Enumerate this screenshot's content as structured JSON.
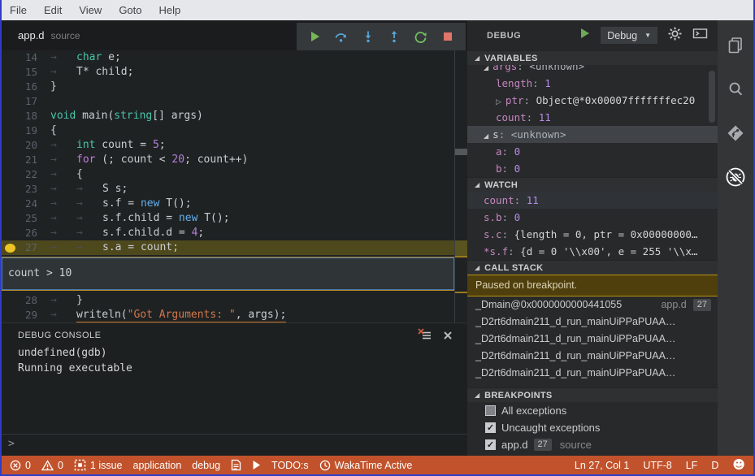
{
  "window": {
    "border_color": "#2F3DC4"
  },
  "menu_bar": {
    "items": [
      "File",
      "Edit",
      "View",
      "Goto",
      "Help"
    ]
  },
  "tab_bar": {
    "title": "app.d",
    "subtitle": "source"
  },
  "debug_toolbar": {
    "buttons": [
      "continue",
      "step-over",
      "step-into",
      "step-out",
      "restart",
      "stop"
    ]
  },
  "editor": {
    "current_line": 27,
    "breakpoint_line": 27,
    "lines": [
      {
        "num": "14",
        "segs": [
          [
            "tab",
            "→"
          ],
          [
            "type",
            "char"
          ],
          [
            "plain",
            " e;"
          ]
        ]
      },
      {
        "num": "15",
        "segs": [
          [
            "tab",
            "→"
          ],
          [
            "plain",
            "T* child;"
          ]
        ]
      },
      {
        "num": "16",
        "segs": [
          [
            "plain",
            "}"
          ]
        ]
      },
      {
        "num": "17",
        "segs": []
      },
      {
        "num": "18",
        "segs": [
          [
            "type",
            "void"
          ],
          [
            "plain",
            " main("
          ],
          [
            "type",
            "string"
          ],
          [
            "plain",
            "[] args)"
          ]
        ]
      },
      {
        "num": "19",
        "segs": [
          [
            "plain",
            "{"
          ]
        ]
      },
      {
        "num": "20",
        "segs": [
          [
            "tab",
            "→"
          ],
          [
            "type",
            "int"
          ],
          [
            "plain",
            " count = "
          ],
          [
            "num",
            "5"
          ],
          [
            "plain",
            ";"
          ]
        ]
      },
      {
        "num": "21",
        "segs": [
          [
            "tab",
            "→"
          ],
          [
            "ctrl",
            "for"
          ],
          [
            "plain",
            " (; count < "
          ],
          [
            "num",
            "20"
          ],
          [
            "plain",
            "; count++)"
          ]
        ]
      },
      {
        "num": "22",
        "segs": [
          [
            "tab",
            "→"
          ],
          [
            "plain",
            "{"
          ]
        ]
      },
      {
        "num": "23",
        "segs": [
          [
            "tab",
            "→"
          ],
          [
            "tab",
            "→"
          ],
          [
            "plain",
            "S s;"
          ]
        ]
      },
      {
        "num": "24",
        "segs": [
          [
            "tab",
            "→"
          ],
          [
            "tab",
            "→"
          ],
          [
            "plain",
            "s.f = "
          ],
          [
            "new",
            "new"
          ],
          [
            "plain",
            " T();"
          ]
        ]
      },
      {
        "num": "25",
        "segs": [
          [
            "tab",
            "→"
          ],
          [
            "tab",
            "→"
          ],
          [
            "plain",
            "s.f.child = "
          ],
          [
            "new",
            "new"
          ],
          [
            "plain",
            " T();"
          ]
        ]
      },
      {
        "num": "26",
        "segs": [
          [
            "tab",
            "→"
          ],
          [
            "tab",
            "→"
          ],
          [
            "plain",
            "s.f.child.d = "
          ],
          [
            "num",
            "4"
          ],
          [
            "plain",
            ";"
          ]
        ]
      },
      {
        "num": "27",
        "current": true,
        "breakpoint": true,
        "segs": [
          [
            "tab",
            "→"
          ],
          [
            "tab",
            "→"
          ],
          [
            "plain",
            "s.a = count;"
          ]
        ]
      },
      {
        "widget": true,
        "value": "count > 10"
      },
      {
        "num": "28",
        "segs": [
          [
            "tab",
            "→"
          ],
          [
            "plain",
            "}"
          ]
        ]
      },
      {
        "num": "29",
        "warn": true,
        "segs": [
          [
            "tab",
            "→"
          ],
          [
            "plain",
            "writeln("
          ],
          [
            "str",
            "\"Got Arguments: \""
          ],
          [
            "plain",
            ", args);"
          ]
        ]
      }
    ]
  },
  "debug_console": {
    "title": "DEBUG CONSOLE",
    "lines": [
      "undefined(gdb)",
      "Running executable"
    ],
    "prompt": ">"
  },
  "panel": {
    "title": "DEBUG",
    "config": "Debug",
    "variables": {
      "title": "VARIABLES",
      "rows": [
        {
          "clip": true,
          "indent": 1,
          "arrow": "open",
          "name": "args",
          "value": "<unknown>",
          "vt": "unk"
        },
        {
          "indent": 2,
          "name": "length",
          "value": "1",
          "vt": "num"
        },
        {
          "indent": 2,
          "arrow": "closed",
          "name": "ptr",
          "value": "Object@*0x00007fffffffec20",
          "vt": "obj"
        },
        {
          "indent": 2,
          "name": "count",
          "value": "11",
          "vt": "num"
        },
        {
          "indent": 1,
          "arrow": "open",
          "name": "s",
          "value": "<unknown>",
          "vt": "unk",
          "selected": true,
          "plain": true
        },
        {
          "indent": 2,
          "name": "a",
          "value": "0",
          "vt": "num"
        },
        {
          "indent": 2,
          "name": "b",
          "value": "0",
          "vt": "num"
        }
      ]
    },
    "watch": {
      "title": "WATCH",
      "rows": [
        {
          "name": "count",
          "value": "11",
          "vt": "num",
          "hover": true
        },
        {
          "name": "s.b",
          "value": "0",
          "vt": "num"
        },
        {
          "name": "s.c",
          "value": "{length = 0, ptr = 0x00000000…",
          "vt": "obj"
        },
        {
          "name": "*s.f",
          "value": "{d = 0 '\\\\x00', e = 255 '\\\\x…",
          "vt": "obj"
        }
      ]
    },
    "call_stack": {
      "title": "CALL STACK",
      "status": "Paused on breakpoint.",
      "frames": [
        {
          "label": "_Dmain@0x0000000000441055",
          "file": "app.d",
          "line": "27"
        },
        {
          "label": "_D2rt6dmain211_d_run_mainUiPPaPUAA…"
        },
        {
          "label": "_D2rt6dmain211_d_run_mainUiPPaPUAA…"
        },
        {
          "label": "_D2rt6dmain211_d_run_mainUiPPaPUAA…"
        },
        {
          "label": "_D2rt6dmain211_d_run_mainUiPPaPUAA…"
        }
      ]
    },
    "breakpoints": {
      "title": "BREAKPOINTS",
      "items": [
        {
          "checked": false,
          "label": "All exceptions"
        },
        {
          "checked": true,
          "label": "Uncaught exceptions"
        },
        {
          "checked": true,
          "label": "app.d",
          "badge": "27",
          "suffix": "source"
        }
      ]
    }
  },
  "status_bar": {
    "errors": "0",
    "warnings": "0",
    "issues": "1 issue",
    "project": "application",
    "mode": "debug",
    "todo": "TODO:s",
    "wakatime": "WakaTime Active",
    "position": "Ln 27, Col 1",
    "encoding": "UTF-8",
    "eol": "LF",
    "language": "D"
  },
  "colors": {
    "status_bar": "#C1522B",
    "window_border": "#2F3DC4",
    "breakpoint_dot": "#EDC425",
    "current_line_bg": "#4E491D",
    "banner_bg": "#4F3F0D",
    "banner_border": "#B89612",
    "keyword_type": "#49C5AC",
    "keyword_flow": "#C678DD",
    "keyword_new": "#61AFEF",
    "number": "#B180D7",
    "string": "#D2774A",
    "variable_name": "#C586C0",
    "value_purple": "#B48CE8"
  }
}
